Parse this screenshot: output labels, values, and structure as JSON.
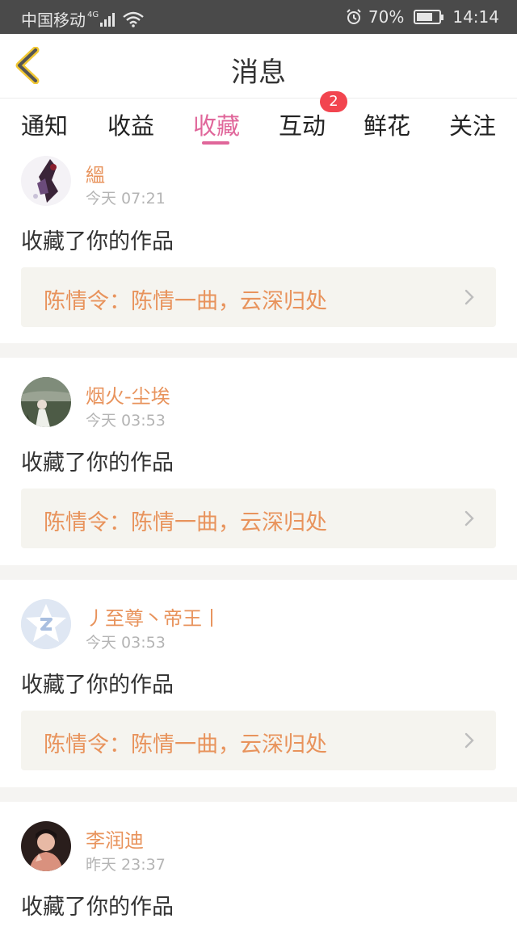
{
  "status_bar": {
    "carrier": "中国移动",
    "network": "4G",
    "battery": "70%",
    "battery_level": 0.7,
    "time": "14:14"
  },
  "header": {
    "title": "消息"
  },
  "tabs": [
    {
      "label": "通知"
    },
    {
      "label": "收益"
    },
    {
      "label": "收藏"
    },
    {
      "label": "互动"
    },
    {
      "label": "鲜花"
    },
    {
      "label": "关注"
    }
  ],
  "active_tab": "收藏",
  "badge": {
    "tab": "互动",
    "count": "2"
  },
  "feed": [
    {
      "user": "縕",
      "time": "今天 07:21",
      "action": "收藏了你的作品",
      "work": "陈情令：陈情一曲，云深归处"
    },
    {
      "user": "烟火-尘埃",
      "time": "今天 03:53",
      "action": "收藏了你的作品",
      "work": "陈情令：陈情一曲，云深归处"
    },
    {
      "user": "丿至尊丶帝王丨",
      "time": "今天 03:53",
      "action": "收藏了你的作品",
      "work": "陈情令：陈情一曲，云深归处"
    },
    {
      "user": "李润迪",
      "time": "昨天 23:37",
      "action": "收藏了你的作品"
    }
  ],
  "colors": {
    "accent": "#e0669a",
    "name": "#e8935c",
    "badge": "#f2454f",
    "status_bar": "#4a4a4a"
  }
}
